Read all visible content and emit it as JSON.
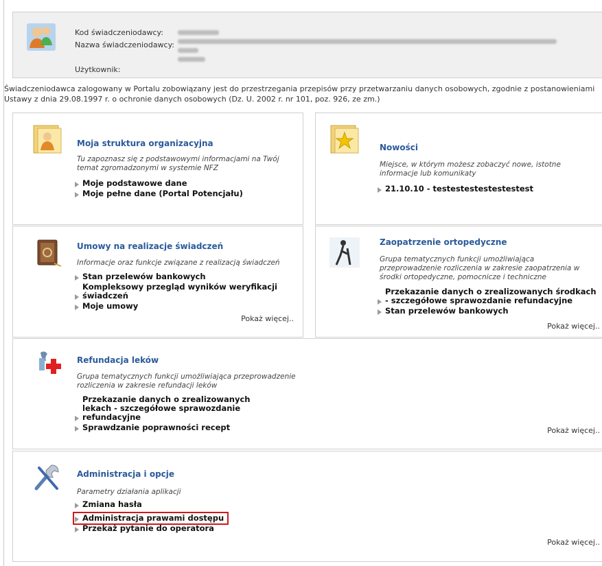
{
  "header": {
    "labels": {
      "provider_code": "Kod świadczeniodawcy:",
      "provider_name": "Nazwa świadczeniodawcy:",
      "user": "Użytkownik:"
    }
  },
  "notice": "Świadczeniodawca zalogowany w Portalu zobowiązany jest do przestrzegania przepisów przy przetwarzaniu danych osobowych, zgodnie z postanowieniami Ustawy z dnia 29.08.1997 r. o ochronie danych osobowych (Dz. U. 2002 r. nr 101, poz. 926, ze zm.)",
  "panels": {
    "structure": {
      "title": "Moja struktura organizacyjna",
      "desc": "Tu zapoznasz się z podstawowymi informacjami na Twój temat zgromadzonymi w systemie NFZ",
      "links": [
        "Moje podstawowe dane",
        "Moje pełne dane (Portal Potencjału)"
      ]
    },
    "news": {
      "title": "Nowości",
      "desc": "Miejsce, w którym możesz zobaczyć nowe, istotne informacje lub komunikaty",
      "links": [
        "21.10.10 - testestestestestestest"
      ]
    },
    "contracts": {
      "title": "Umowy na realizacje świadczeń",
      "desc": "Informacje oraz funkcje związane z realizacją świadczeń",
      "links": [
        "Stan przelewów bankowych",
        "Kompleksowy przegląd wyników weryfikacji świadczeń",
        "Moje umowy"
      ],
      "more": "Pokaż więcej.."
    },
    "orthopedic": {
      "title": "Zaopatrzenie ortopedyczne",
      "desc": "Grupa tematycznych funkcji umożliwiająca przeprowadzenie rozliczenia w zakresie zaopatrzenia w środki ortopedyczne, pomocnicze i techniczne",
      "links": [
        "Przekazanie danych o zrealizowanych środkach - szczegółowe sprawozdanie refundacyjne",
        "Stan przelewów bankowych"
      ],
      "more": "Pokaż więcej.."
    },
    "drugs": {
      "title": "Refundacja leków",
      "desc": "Grupa tematycznych funkcji umożliwiająca przeprowadzenie rozliczenia w zakresie refundacji leków",
      "links": [
        "Przekazanie danych o zrealizowanych lekach - szczegółowe sprawozdanie refundacyjne",
        "Sprawdzanie poprawności recept"
      ],
      "more": "Pokaż więcej.."
    },
    "admin": {
      "title": "Administracja i opcje",
      "desc": "Parametry działania aplikacji",
      "links": [
        "Zmiana hasła",
        "Administracja prawami dostępu",
        "Przekaż pytanie do operatora"
      ],
      "more": "Pokaż więcej.."
    }
  },
  "colors": {
    "title_blue": "#2a5a9a",
    "highlight_red": "#cc1a1a",
    "panel_border": "#cfcfcf",
    "header_bg": "#f0f0f0"
  },
  "icons": [
    "users-icon",
    "folder-user-icon",
    "folder-star-icon",
    "contract-book-icon",
    "crutch-person-icon",
    "pharmacy-cross-icon",
    "tools-icon"
  ]
}
